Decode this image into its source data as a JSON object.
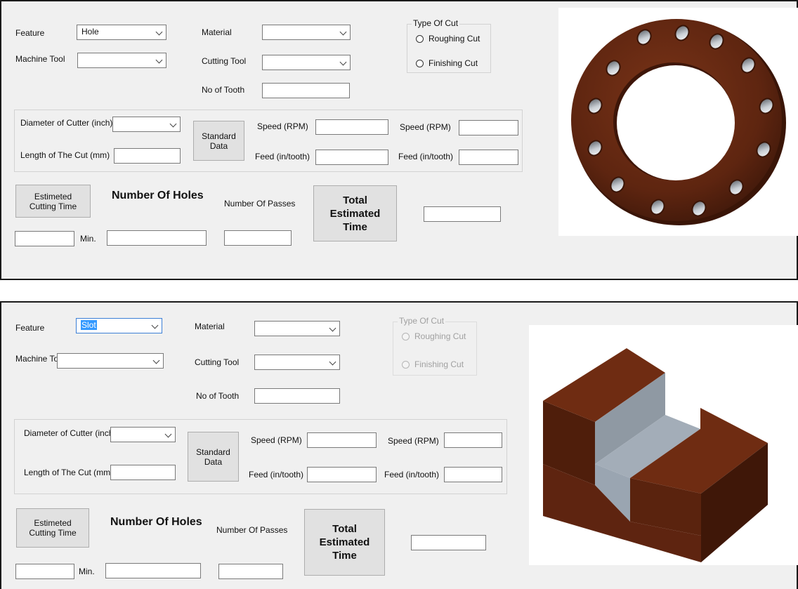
{
  "panel_top": {
    "feature_label": "Feature",
    "feature_value": "Hole",
    "machine_tool_label": "Machine Tool",
    "material_label": "Material",
    "cutting_tool_label": "Cutting Tool",
    "no_of_tooth_label": "No of Tooth",
    "type_of_cut_title": "Type Of Cut",
    "roughing_label": "Roughing Cut",
    "finishing_label": "Finishing Cut",
    "diameter_label": "Diameter of Cutter (inch)",
    "length_label": "Length of The Cut (mm)",
    "standard_data_label": "Standard Data",
    "speed1_label": "Speed (RPM)",
    "feed1_label": "Feed (in/tooth)",
    "speed2_label": "Speed (RPM)",
    "feed2_label": "Feed (in/tooth)",
    "estimated_cutting_time_label": "Estimeted Cutting Time",
    "number_of_holes_label": "Number Of Holes",
    "number_of_passes_label": "Number Of Passes",
    "total_estimated_time_label": "Total Estimated Time",
    "min_label": "Min."
  },
  "panel_bottom": {
    "feature_label": "Feature",
    "feature_value": "Slot",
    "machine_tool_label": "Machine Tool",
    "material_label": "Material",
    "cutting_tool_label": "Cutting Tool",
    "no_of_tooth_label": "No of Tooth",
    "type_of_cut_title": "Type Of Cut",
    "roughing_label": "Roughing Cut",
    "finishing_label": "Finishing Cut",
    "diameter_label": "Diameter of Cutter (inch)",
    "length_label": "Length of The Cut (mm)",
    "standard_data_label": "Standard Data",
    "speed1_label": "Speed (RPM)",
    "feed1_label": "Feed (in/tooth)",
    "speed2_label": "Speed (RPM)",
    "feed2_label": "Feed (in/tooth)",
    "estimated_cutting_time_label": "Estimeted Cutting Time",
    "number_of_holes_label": "Number Of Holes",
    "number_of_passes_label": "Number Of Passes",
    "total_estimated_time_label": "Total Estimated Time",
    "min_label": "Min."
  },
  "colors": {
    "form_background": "#f0f0f0",
    "material_brown": "#6b2a12",
    "slot_grey": "#9aa5b1"
  },
  "icons": {
    "flange_image": "flange-with-bolt-holes",
    "slot_image": "block-with-slot"
  }
}
